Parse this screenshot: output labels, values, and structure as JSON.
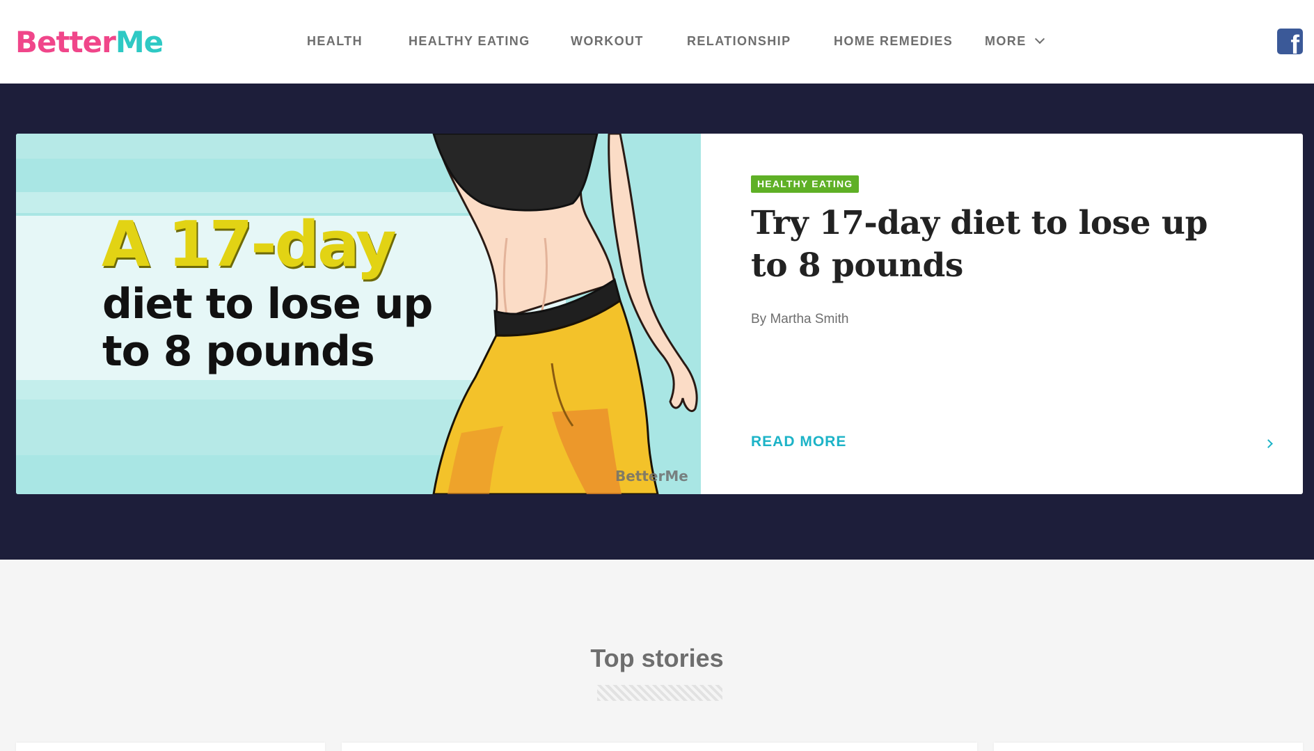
{
  "logo": {
    "part1": "Better",
    "part2": "Me"
  },
  "nav": {
    "items": [
      {
        "label": "HEALTH"
      },
      {
        "label": "HEALTHY EATING"
      },
      {
        "label": "WORKOUT"
      },
      {
        "label": "RELATIONSHIP"
      },
      {
        "label": "HOME REMEDIES"
      },
      {
        "label": "MORE"
      }
    ]
  },
  "social": {
    "facebook_icon": "facebook-icon",
    "facebook_glyph": "f"
  },
  "hero": {
    "image_text": {
      "big": "A 17-day",
      "line1": "diet to lose up",
      "line2": "to 8 pounds",
      "watermark": "BetterMe"
    },
    "tag": "HEALTHY EATING",
    "headline": "Try 17-day diet to lose up to 8 pounds",
    "byline": "By Martha Smith",
    "read_more": "READ MORE"
  },
  "section": {
    "title": "Top stories"
  },
  "colors": {
    "logo_pink": "#f0468a",
    "logo_teal": "#2ec9c4",
    "hero_band": "#1d1e3a",
    "tag_green": "#5fb026",
    "accent_teal": "#1cb3c7",
    "facebook_blue": "#3b5998"
  }
}
